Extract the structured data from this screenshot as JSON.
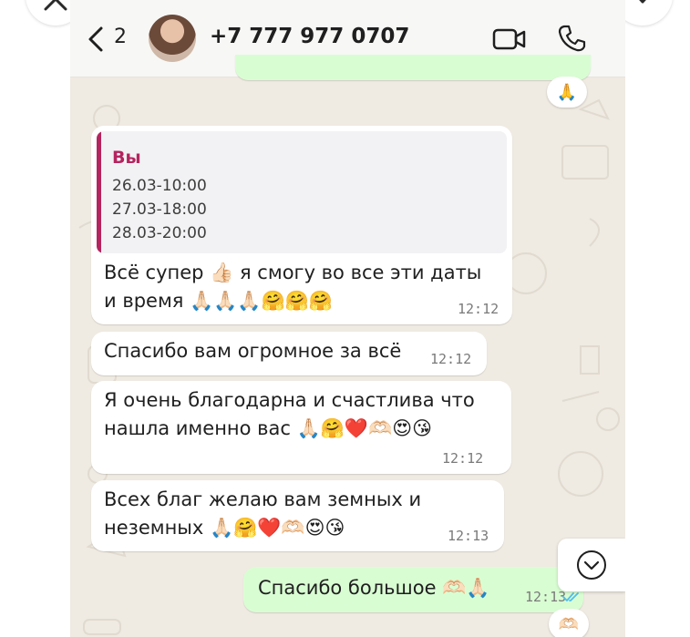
{
  "header": {
    "back_count": "2",
    "contact_name": "+7 777 977 0707"
  },
  "messages": [
    {
      "quote_author": "Вы",
      "quote_lines": [
        "26.03-10:00",
        "27.03-18:00",
        "28.03-20:00"
      ],
      "text": "Всё супер 👍🏻 я смогу во все эти даты\nи время 🙏🏻🙏🏻🙏🏻🤗🤗🤗",
      "time": "12:12"
    },
    {
      "text": "Спасибо вам огромное за всё",
      "time": "12:12"
    },
    {
      "text": "Я очень благодарна и счастлива что\nнашла именно вас 🙏🏻🤗❤️🫶🏻😍😘",
      "time": "12:12"
    },
    {
      "text": "Всех благ желаю вам земных и\nнеземных 🙏🏻🤗❤️🫶🏻😍😘",
      "time": "12:13"
    },
    {
      "text": "Спасибо большое 🫶🏻🙏🏻",
      "time": "12:13",
      "status": "read"
    }
  ],
  "reactions": {
    "top": "🙏",
    "bottom": "🫶🏻"
  },
  "colors": {
    "accent_quote": "#b5245f",
    "outgoing_bubble": "#d9fdd3",
    "incoming_bubble": "#ffffff",
    "chat_background": "#efeae2",
    "read_ticks": "#53bdeb"
  },
  "icons": [
    "close-icon",
    "share-icon",
    "heart-icon",
    "chevron-left-icon",
    "video-camera-icon",
    "phone-icon",
    "chevron-down-circle-icon",
    "double-check-icon"
  ]
}
